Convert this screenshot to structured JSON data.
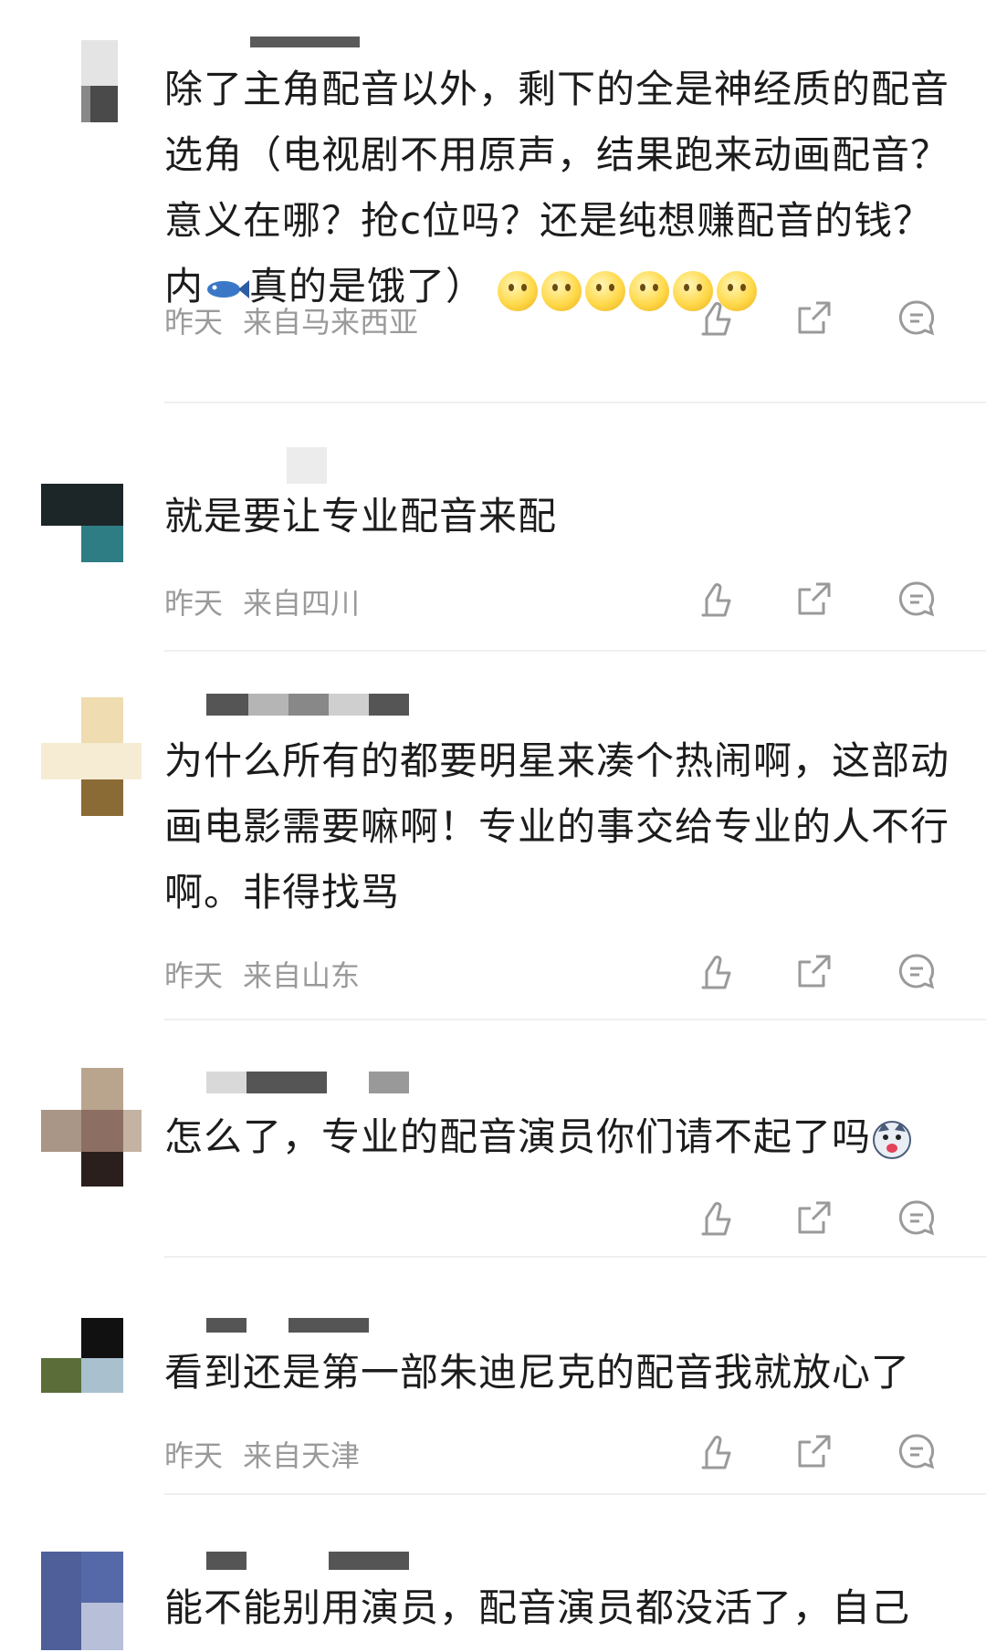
{
  "comments": [
    {
      "text": "除了主角配音以外，剩下的全是神经质的配音选角（电视剧不用原声，结果跑来动画配音？意义在哪？抢c位吗？还是纯想赚配音的钱？内",
      "text_tail": "真的是饿了）",
      "time": "昨天",
      "location": "来自马来西亚"
    },
    {
      "text": "就是要让专业配音来配",
      "time": "昨天",
      "location": "来自四川"
    },
    {
      "text": "为什么所有的都要明星来凑个热闹啊，这部动画电影需要嘛啊！专业的事交给专业的人不行啊。非得找骂",
      "time": "昨天",
      "location": "来自山东"
    },
    {
      "text": "怎么了，专业的配音演员你们请不起了吗",
      "time": "",
      "location": ""
    },
    {
      "text": "看到还是第一部朱迪尼克的配音我就放心了",
      "time": "昨天",
      "location": "来自天津"
    },
    {
      "text": "能不能别用演员，配音演员都没活了，自己"
    }
  ],
  "icons": {
    "like": "thumbs-up-icon",
    "share": "share-icon",
    "reply": "comment-icon"
  },
  "colors": {
    "text": "#1c1c1c",
    "meta": "#9a9a9a",
    "icon": "#9a9a9a",
    "divider": "#efefef"
  }
}
